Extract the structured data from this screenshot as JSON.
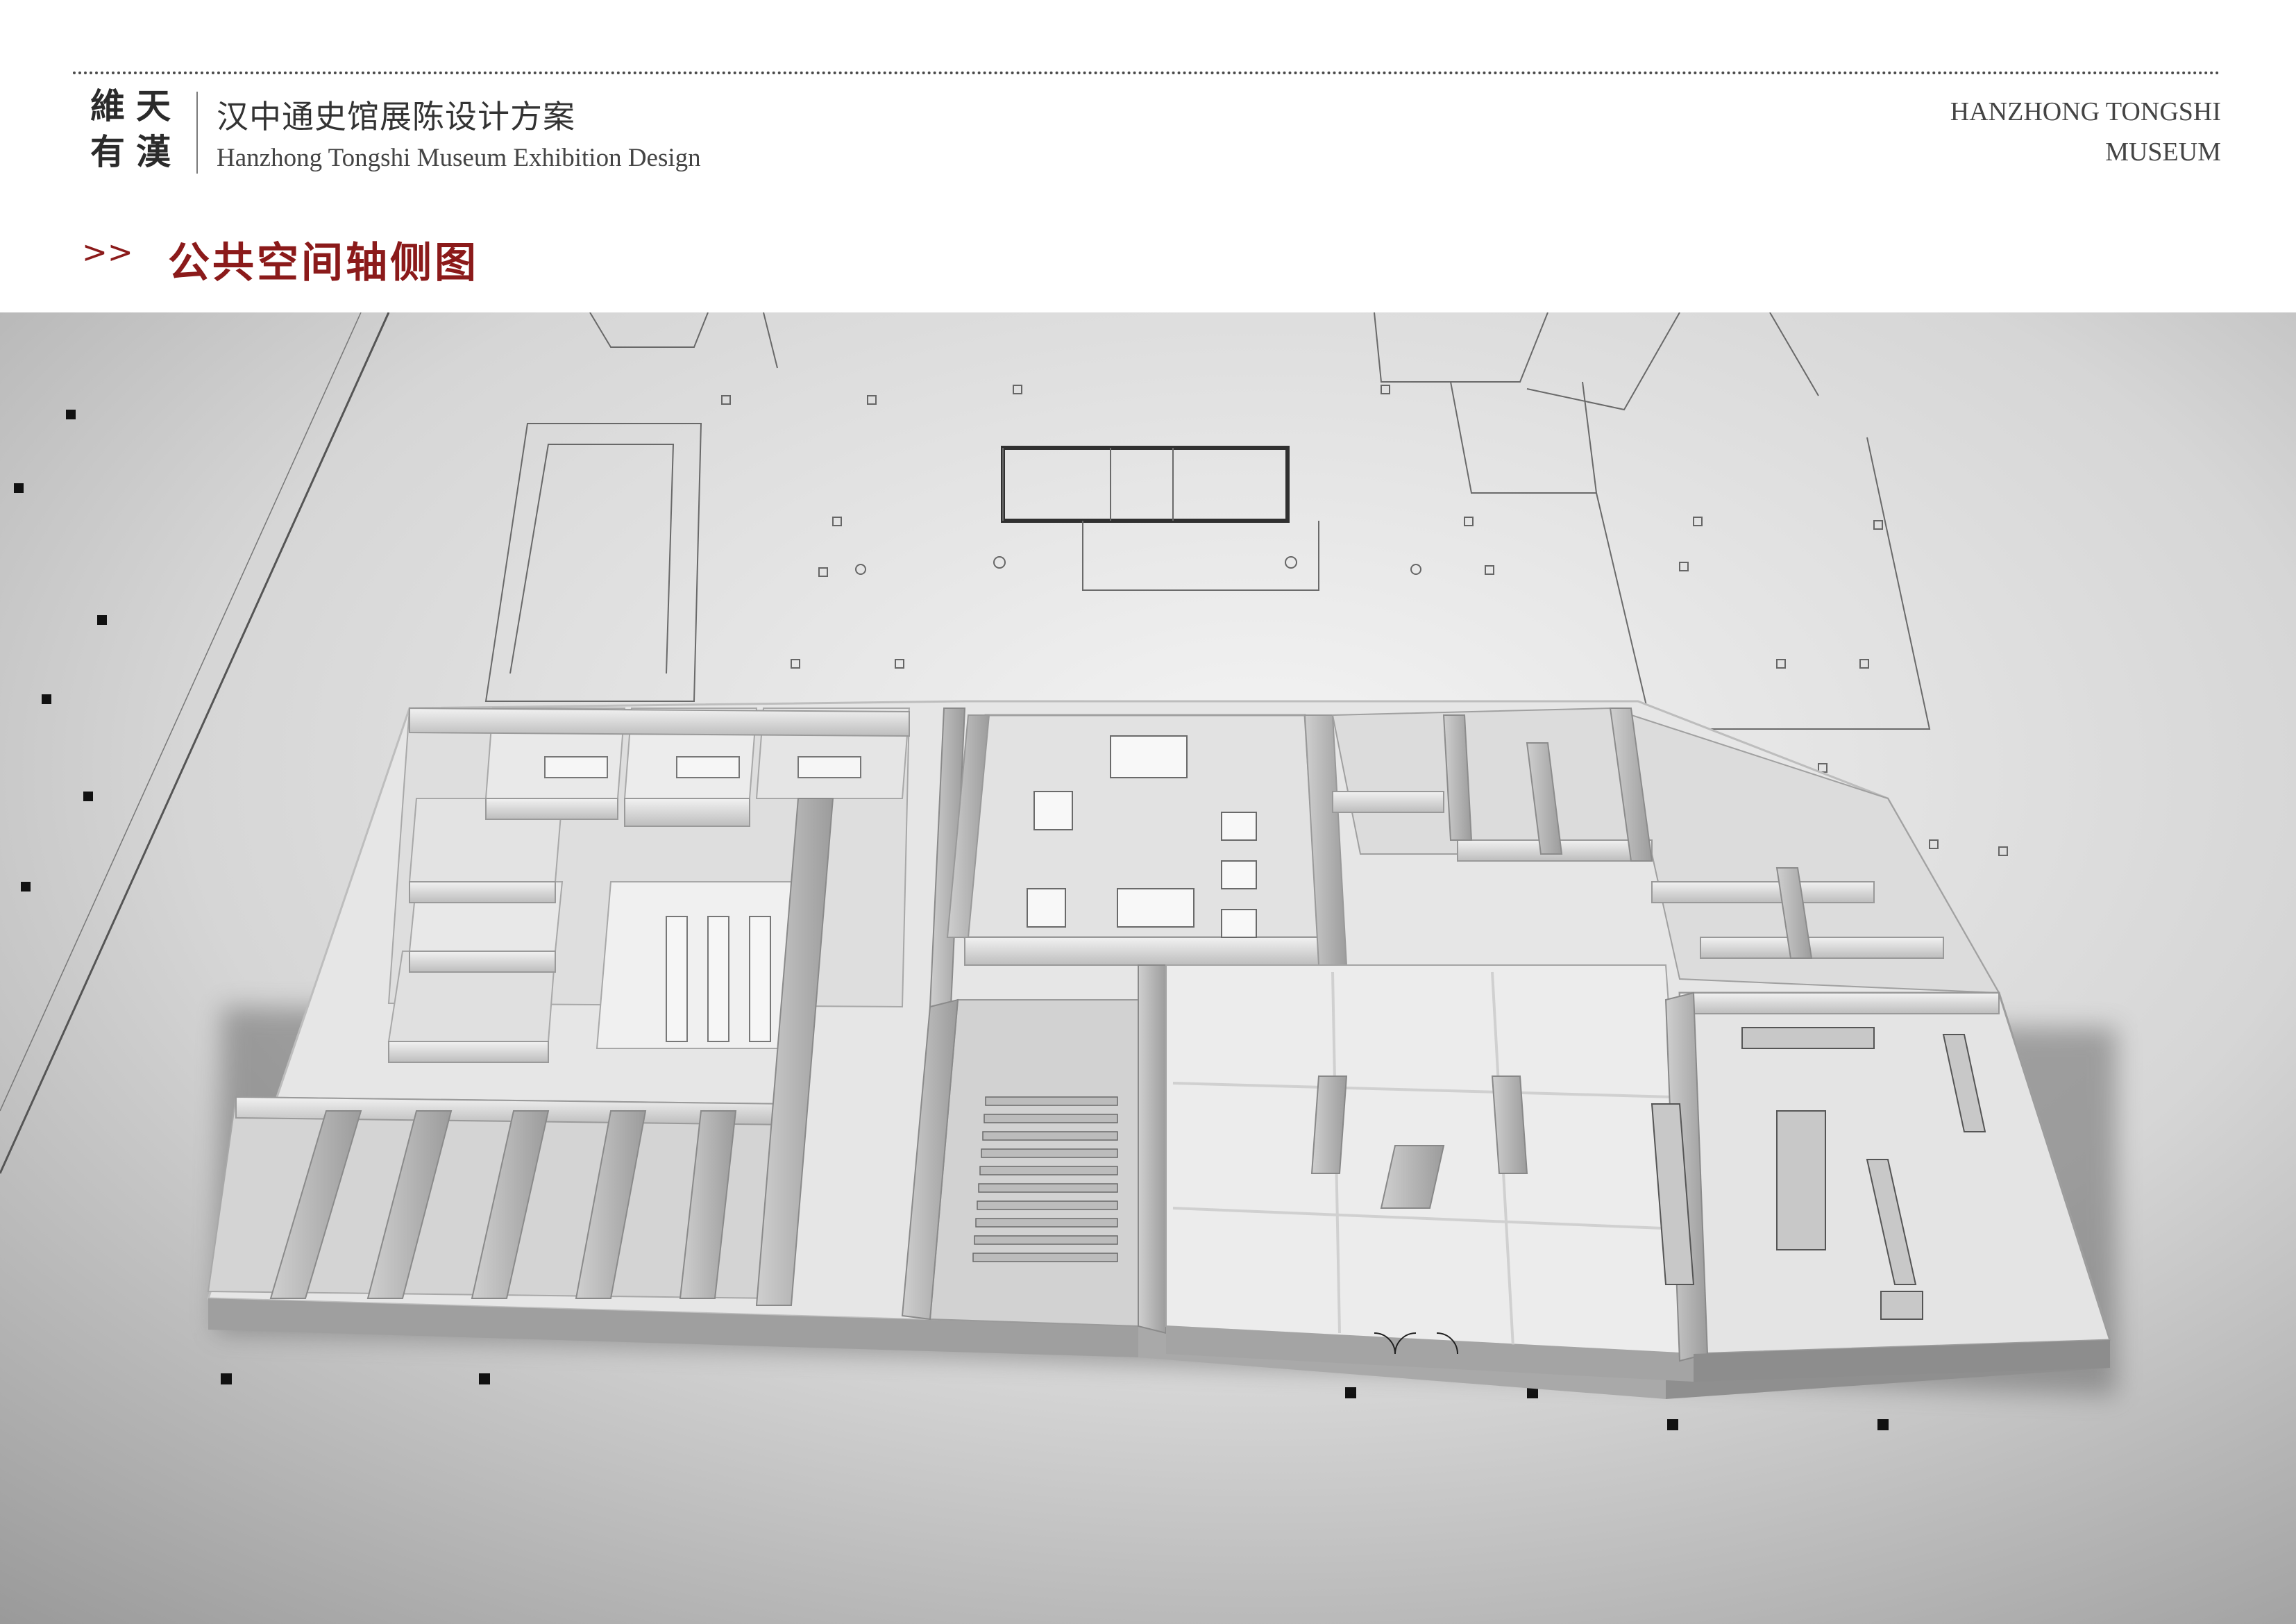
{
  "header": {
    "logo_chars": [
      "維",
      "天",
      "有",
      "漢"
    ],
    "title_cn": "汉中通史馆展陈设计方案",
    "title_en": "Hanzhong Tongshi Museum Exhibition Design",
    "brand_line1": "HANZHONG TONGSHI",
    "brand_line2": "MUSEUM"
  },
  "section": {
    "arrow": ">>",
    "title": "公共空间轴侧图"
  },
  "colors": {
    "accent": "#8b1a1a",
    "text": "#333333",
    "background_top": "#ffffff",
    "render_floor": "#d9d9d9"
  },
  "illustration": {
    "type": "axonometric-3d-floor-plan-render"
  }
}
